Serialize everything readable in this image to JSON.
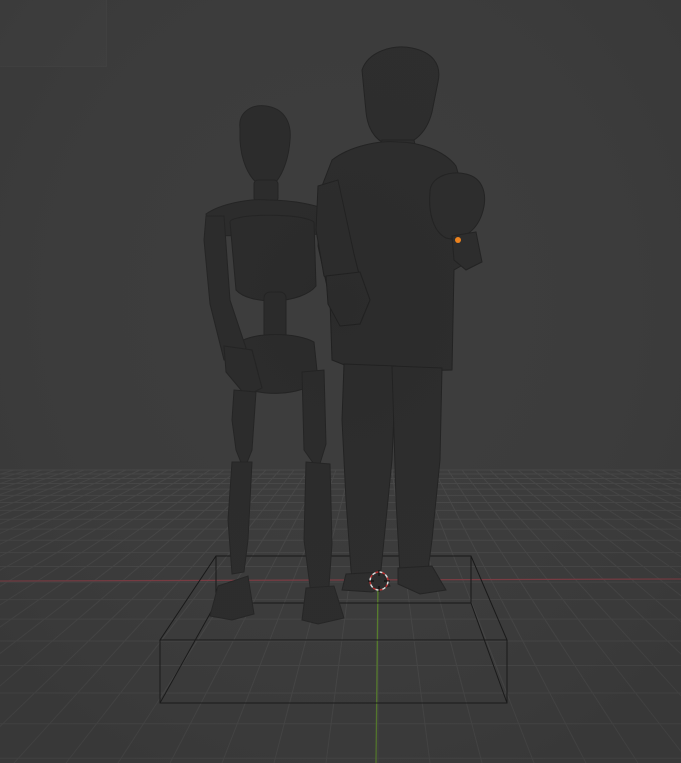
{
  "viewport": {
    "mode": "3D viewport",
    "shading": "solid",
    "background_color": "#3d3d3d",
    "grid_color": "#4a4a4a",
    "x_axis_color": "#8a3d46",
    "y_axis_color": "#5f8f2a",
    "model_color": "#2a2a2a",
    "origin_color": "#ff8a1a",
    "cursor_colors": [
      "#ffffff",
      "#d32f2f"
    ]
  },
  "scene": {
    "objects": [
      "skeleton-figure",
      "gentleman-figure",
      "bounding-box",
      "3d-cursor"
    ]
  }
}
